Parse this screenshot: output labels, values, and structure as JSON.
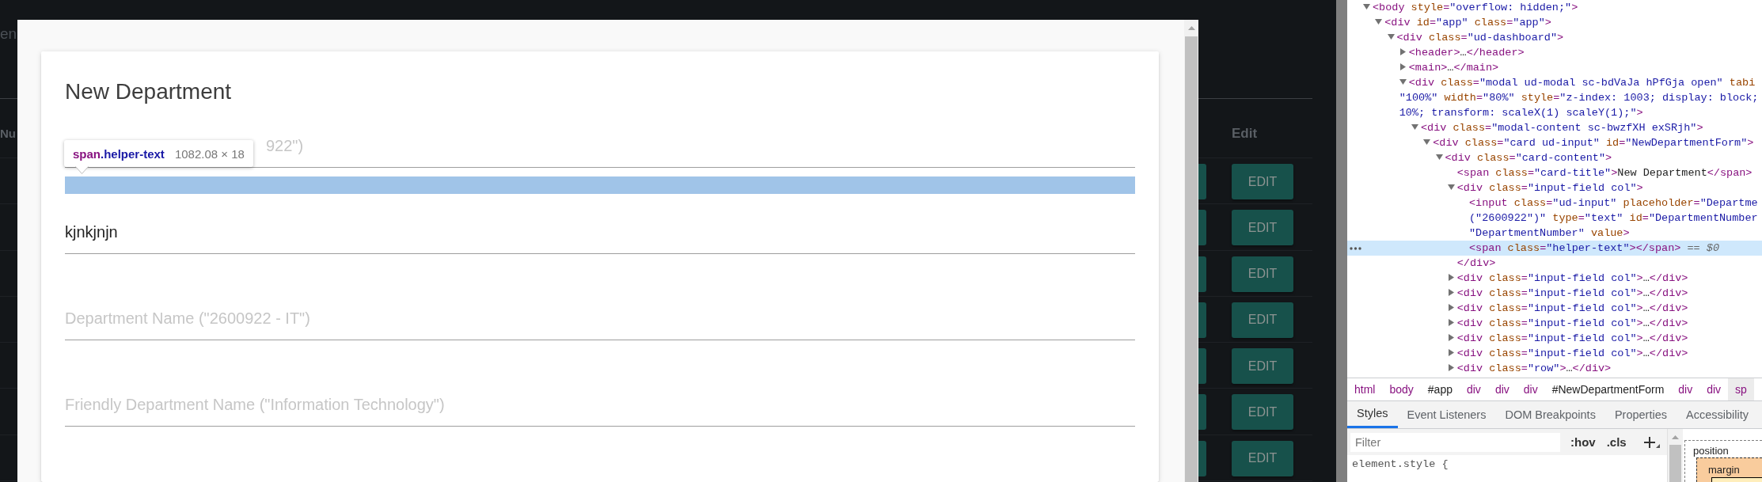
{
  "app": {
    "heading": "en",
    "table": {
      "columns": [
        "Nu",
        "Edit"
      ],
      "rows": [
        {
          "action": "EDIT"
        },
        {
          "action": "EDIT"
        },
        {
          "action": "EDIT"
        },
        {
          "action": "EDIT"
        },
        {
          "action": "EDIT"
        },
        {
          "action": "EDIT"
        },
        {
          "action": "EDIT"
        }
      ]
    }
  },
  "modal": {
    "title": "New Department",
    "fields": [
      {
        "placeholder": "922\")",
        "highlighted": true,
        "tooltip": {
          "tag": "span",
          "class": ".helper-text",
          "size": "1082.08 × 18"
        }
      },
      {
        "value": "kjnkjnjn",
        "highlighted": false
      },
      {
        "placeholder": "Department Name (\"2600922 - IT\")",
        "highlighted": false
      },
      {
        "placeholder": "Friendly Department Name (\"Information Technology\")",
        "highlighted": false
      }
    ]
  },
  "devtools": {
    "elements_tree": [
      {
        "kind": "expanded",
        "selected": false,
        "lines": [
          [
            {
              "kind": "tag",
              "text": "<body"
            },
            {
              "kind": "attr",
              "text": " style"
            },
            {
              "kind": "tag",
              "text": "="
            },
            {
              "kind": "value",
              "text": "\"overflow: hidden;\""
            },
            {
              "kind": "tag",
              "text": ">"
            }
          ]
        ],
        "children": [
          {
            "kind": "expanded",
            "selected": false,
            "lines": [
              [
                {
                  "kind": "tag",
                  "text": "<div"
                },
                {
                  "kind": "attr",
                  "text": " id"
                },
                {
                  "kind": "tag",
                  "text": "="
                },
                {
                  "kind": "value",
                  "text": "\"app\""
                },
                {
                  "kind": "attr",
                  "text": " class"
                },
                {
                  "kind": "tag",
                  "text": "="
                },
                {
                  "kind": "value",
                  "text": "\"app\""
                },
                {
                  "kind": "tag",
                  "text": ">"
                }
              ]
            ],
            "children": [
              {
                "kind": "expanded",
                "selected": false,
                "lines": [
                  [
                    {
                      "kind": "tag",
                      "text": "<div"
                    },
                    {
                      "kind": "attr",
                      "text": " class"
                    },
                    {
                      "kind": "tag",
                      "text": "="
                    },
                    {
                      "kind": "value",
                      "text": "\"ud-dashboard\""
                    },
                    {
                      "kind": "tag",
                      "text": ">"
                    }
                  ]
                ],
                "children": [
                  {
                    "kind": "collapsed",
                    "selected": false,
                    "lines": [
                      [
                        {
                          "kind": "tag",
                          "text": "<header>"
                        },
                        {
                          "kind": "text",
                          "text": "…"
                        },
                        {
                          "kind": "tag",
                          "text": "</header>"
                        }
                      ]
                    ]
                  },
                  {
                    "kind": "collapsed",
                    "selected": false,
                    "lines": [
                      [
                        {
                          "kind": "tag",
                          "text": "<main>"
                        },
                        {
                          "kind": "text",
                          "text": "…"
                        },
                        {
                          "kind": "tag",
                          "text": "</main>"
                        }
                      ]
                    ]
                  },
                  {
                    "kind": "expanded",
                    "selected": false,
                    "lines": [
                      [
                        {
                          "kind": "tag",
                          "text": "<div"
                        },
                        {
                          "kind": "attr",
                          "text": " class"
                        },
                        {
                          "kind": "tag",
                          "text": "="
                        },
                        {
                          "kind": "value",
                          "text": "\"modal ud-modal sc-bdVaJa hPfGja open\""
                        },
                        {
                          "kind": "attr",
                          "text": " tabi"
                        }
                      ],
                      [
                        {
                          "kind": "value",
                          "text": "\"100%\""
                        },
                        {
                          "kind": "attr",
                          "text": " width"
                        },
                        {
                          "kind": "tag",
                          "text": "="
                        },
                        {
                          "kind": "value",
                          "text": "\"80%\""
                        },
                        {
                          "kind": "attr",
                          "text": " style"
                        },
                        {
                          "kind": "tag",
                          "text": "="
                        },
                        {
                          "kind": "value",
                          "text": "\"z-index: 1003; display: block;"
                        }
                      ],
                      [
                        {
                          "kind": "value",
                          "text": "10%; transform: scaleX(1) scaleY(1);\""
                        },
                        {
                          "kind": "tag",
                          "text": ">"
                        }
                      ]
                    ],
                    "children": [
                      {
                        "kind": "expanded",
                        "selected": false,
                        "lines": [
                          [
                            {
                              "kind": "tag",
                              "text": "<div"
                            },
                            {
                              "kind": "attr",
                              "text": " class"
                            },
                            {
                              "kind": "tag",
                              "text": "="
                            },
                            {
                              "kind": "value",
                              "text": "\"modal-content sc-bwzfXH exSRjh\""
                            },
                            {
                              "kind": "tag",
                              "text": ">"
                            }
                          ]
                        ],
                        "children": [
                          {
                            "kind": "expanded",
                            "selected": false,
                            "lines": [
                              [
                                {
                                  "kind": "tag",
                                  "text": "<div"
                                },
                                {
                                  "kind": "attr",
                                  "text": " class"
                                },
                                {
                                  "kind": "tag",
                                  "text": "="
                                },
                                {
                                  "kind": "value",
                                  "text": "\"card ud-input\""
                                },
                                {
                                  "kind": "attr",
                                  "text": " id"
                                },
                                {
                                  "kind": "tag",
                                  "text": "="
                                },
                                {
                                  "kind": "value",
                                  "text": "\"NewDepartmentForm\""
                                },
                                {
                                  "kind": "tag",
                                  "text": ">"
                                }
                              ]
                            ],
                            "children": [
                              {
                                "kind": "expanded",
                                "selected": false,
                                "lines": [
                                  [
                                    {
                                      "kind": "tag",
                                      "text": "<div"
                                    },
                                    {
                                      "kind": "attr",
                                      "text": " class"
                                    },
                                    {
                                      "kind": "tag",
                                      "text": "="
                                    },
                                    {
                                      "kind": "value",
                                      "text": "\"card-content\""
                                    },
                                    {
                                      "kind": "tag",
                                      "text": ">"
                                    }
                                  ]
                                ],
                                "children": [
                                  {
                                    "kind": "leaf",
                                    "selected": false,
                                    "lines": [
                                      [
                                        {
                                          "kind": "tag",
                                          "text": "<span"
                                        },
                                        {
                                          "kind": "attr",
                                          "text": " class"
                                        },
                                        {
                                          "kind": "tag",
                                          "text": "="
                                        },
                                        {
                                          "kind": "value",
                                          "text": "\"card-title\""
                                        },
                                        {
                                          "kind": "tag",
                                          "text": ">"
                                        },
                                        {
                                          "kind": "text",
                                          "text": "New Department"
                                        },
                                        {
                                          "kind": "tag",
                                          "text": "</span>"
                                        }
                                      ]
                                    ]
                                  },
                                  {
                                    "kind": "expanded",
                                    "selected": false,
                                    "lines": [
                                      [
                                        {
                                          "kind": "tag",
                                          "text": "<div"
                                        },
                                        {
                                          "kind": "attr",
                                          "text": " class"
                                        },
                                        {
                                          "kind": "tag",
                                          "text": "="
                                        },
                                        {
                                          "kind": "value",
                                          "text": "\"input-field col\""
                                        },
                                        {
                                          "kind": "tag",
                                          "text": ">"
                                        }
                                      ]
                                    ],
                                    "children": [
                                      {
                                        "kind": "leaf",
                                        "selected": false,
                                        "lines": [
                                          [
                                            {
                                              "kind": "tag",
                                              "text": "<input"
                                            },
                                            {
                                              "kind": "attr",
                                              "text": " class"
                                            },
                                            {
                                              "kind": "tag",
                                              "text": "="
                                            },
                                            {
                                              "kind": "value",
                                              "text": "\"ud-input\""
                                            },
                                            {
                                              "kind": "attr",
                                              "text": " placeholder"
                                            },
                                            {
                                              "kind": "tag",
                                              "text": "="
                                            },
                                            {
                                              "kind": "value",
                                              "text": "\"Departme"
                                            }
                                          ],
                                          [
                                            {
                                              "kind": "value",
                                              "text": "(\"2600922\")\""
                                            },
                                            {
                                              "kind": "attr",
                                              "text": " type"
                                            },
                                            {
                                              "kind": "tag",
                                              "text": "="
                                            },
                                            {
                                              "kind": "value",
                                              "text": "\"text\""
                                            },
                                            {
                                              "kind": "attr",
                                              "text": " id"
                                            },
                                            {
                                              "kind": "tag",
                                              "text": "="
                                            },
                                            {
                                              "kind": "value",
                                              "text": "\"DepartmentNumber"
                                            }
                                          ],
                                          [
                                            {
                                              "kind": "value",
                                              "text": "\"DepartmentNumber\""
                                            },
                                            {
                                              "kind": "attr",
                                              "text": " value"
                                            },
                                            {
                                              "kind": "tag",
                                              "text": ">"
                                            }
                                          ]
                                        ]
                                      },
                                      {
                                        "kind": "leaf",
                                        "selected": true,
                                        "lines": [
                                          [
                                            {
                                              "kind": "tag",
                                              "text": "<span"
                                            },
                                            {
                                              "kind": "attr",
                                              "text": " class"
                                            },
                                            {
                                              "kind": "tag",
                                              "text": "="
                                            },
                                            {
                                              "kind": "value",
                                              "text": "\"helper-text\""
                                            },
                                            {
                                              "kind": "tag",
                                              "text": "></span>"
                                            },
                                            {
                                              "kind": "ref",
                                              "text": " == $0"
                                            }
                                          ]
                                        ]
                                      }
                                    ],
                                    "closing": [
                                      {
                                        "kind": "tag",
                                        "text": "</div>"
                                      }
                                    ]
                                  },
                                  {
                                    "kind": "collapsed",
                                    "selected": false,
                                    "lines": [
                                      [
                                        {
                                          "kind": "tag",
                                          "text": "<div"
                                        },
                                        {
                                          "kind": "attr",
                                          "text": " class"
                                        },
                                        {
                                          "kind": "tag",
                                          "text": "="
                                        },
                                        {
                                          "kind": "value",
                                          "text": "\"input-field col\""
                                        },
                                        {
                                          "kind": "tag",
                                          "text": ">"
                                        },
                                        {
                                          "kind": "text",
                                          "text": "…"
                                        },
                                        {
                                          "kind": "tag",
                                          "text": "</div>"
                                        }
                                      ]
                                    ]
                                  },
                                  {
                                    "kind": "collapsed",
                                    "selected": false,
                                    "lines": [
                                      [
                                        {
                                          "kind": "tag",
                                          "text": "<div"
                                        },
                                        {
                                          "kind": "attr",
                                          "text": " class"
                                        },
                                        {
                                          "kind": "tag",
                                          "text": "="
                                        },
                                        {
                                          "kind": "value",
                                          "text": "\"input-field col\""
                                        },
                                        {
                                          "kind": "tag",
                                          "text": ">"
                                        },
                                        {
                                          "kind": "text",
                                          "text": "…"
                                        },
                                        {
                                          "kind": "tag",
                                          "text": "</div>"
                                        }
                                      ]
                                    ]
                                  },
                                  {
                                    "kind": "collapsed",
                                    "selected": false,
                                    "lines": [
                                      [
                                        {
                                          "kind": "tag",
                                          "text": "<div"
                                        },
                                        {
                                          "kind": "attr",
                                          "text": " class"
                                        },
                                        {
                                          "kind": "tag",
                                          "text": "="
                                        },
                                        {
                                          "kind": "value",
                                          "text": "\"input-field col\""
                                        },
                                        {
                                          "kind": "tag",
                                          "text": ">"
                                        },
                                        {
                                          "kind": "text",
                                          "text": "…"
                                        },
                                        {
                                          "kind": "tag",
                                          "text": "</div>"
                                        }
                                      ]
                                    ]
                                  },
                                  {
                                    "kind": "collapsed",
                                    "selected": false,
                                    "lines": [
                                      [
                                        {
                                          "kind": "tag",
                                          "text": "<div"
                                        },
                                        {
                                          "kind": "attr",
                                          "text": " class"
                                        },
                                        {
                                          "kind": "tag",
                                          "text": "="
                                        },
                                        {
                                          "kind": "value",
                                          "text": "\"input-field col\""
                                        },
                                        {
                                          "kind": "tag",
                                          "text": ">"
                                        },
                                        {
                                          "kind": "text",
                                          "text": "…"
                                        },
                                        {
                                          "kind": "tag",
                                          "text": "</div>"
                                        }
                                      ]
                                    ]
                                  },
                                  {
                                    "kind": "collapsed",
                                    "selected": false,
                                    "lines": [
                                      [
                                        {
                                          "kind": "tag",
                                          "text": "<div"
                                        },
                                        {
                                          "kind": "attr",
                                          "text": " class"
                                        },
                                        {
                                          "kind": "tag",
                                          "text": "="
                                        },
                                        {
                                          "kind": "value",
                                          "text": "\"input-field col\""
                                        },
                                        {
                                          "kind": "tag",
                                          "text": ">"
                                        },
                                        {
                                          "kind": "text",
                                          "text": "…"
                                        },
                                        {
                                          "kind": "tag",
                                          "text": "</div>"
                                        }
                                      ]
                                    ]
                                  },
                                  {
                                    "kind": "collapsed",
                                    "selected": false,
                                    "lines": [
                                      [
                                        {
                                          "kind": "tag",
                                          "text": "<div"
                                        },
                                        {
                                          "kind": "attr",
                                          "text": " class"
                                        },
                                        {
                                          "kind": "tag",
                                          "text": "="
                                        },
                                        {
                                          "kind": "value",
                                          "text": "\"input-field col\""
                                        },
                                        {
                                          "kind": "tag",
                                          "text": ">"
                                        },
                                        {
                                          "kind": "text",
                                          "text": "…"
                                        },
                                        {
                                          "kind": "tag",
                                          "text": "</div>"
                                        }
                                      ]
                                    ]
                                  },
                                  {
                                    "kind": "collapsed",
                                    "selected": false,
                                    "lines": [
                                      [
                                        {
                                          "kind": "tag",
                                          "text": "<div"
                                        },
                                        {
                                          "kind": "attr",
                                          "text": " class"
                                        },
                                        {
                                          "kind": "tag",
                                          "text": "="
                                        },
                                        {
                                          "kind": "value",
                                          "text": "\"row\""
                                        },
                                        {
                                          "kind": "tag",
                                          "text": ">"
                                        },
                                        {
                                          "kind": "text",
                                          "text": "…"
                                        },
                                        {
                                          "kind": "tag",
                                          "text": "</div>"
                                        }
                                      ]
                                    ]
                                  }
                                ]
                              }
                            ]
                          }
                        ]
                      }
                    ]
                  }
                ]
              }
            ]
          }
        ]
      }
    ],
    "breadcrumbs": [
      {
        "label": "html",
        "kind": "tag",
        "selected": false
      },
      {
        "label": "body",
        "kind": "tag",
        "selected": false
      },
      {
        "label": "#app",
        "kind": "id",
        "selected": false
      },
      {
        "label": "div",
        "kind": "tag",
        "selected": false
      },
      {
        "label": "div",
        "kind": "tag",
        "selected": false
      },
      {
        "label": "div",
        "kind": "tag",
        "selected": false
      },
      {
        "label": "#NewDepartmentForm",
        "kind": "id",
        "selected": false
      },
      {
        "label": "div",
        "kind": "tag",
        "selected": false
      },
      {
        "label": "div",
        "kind": "tag",
        "selected": false
      },
      {
        "label": "sp",
        "kind": "tag",
        "selected": true
      }
    ],
    "tabs": [
      {
        "label": "Styles",
        "selected": true
      },
      {
        "label": "Event Listeners",
        "selected": false
      },
      {
        "label": "DOM Breakpoints",
        "selected": false
      },
      {
        "label": "Properties",
        "selected": false
      },
      {
        "label": "Accessibility",
        "selected": false
      }
    ],
    "styles": {
      "filter": {
        "placeholder": "Filter"
      },
      "buttons": [
        ":hov",
        ".cls"
      ],
      "rules": [
        "element.style {"
      ]
    },
    "box_model": {
      "labels": [
        "position",
        "margin"
      ]
    }
  }
}
